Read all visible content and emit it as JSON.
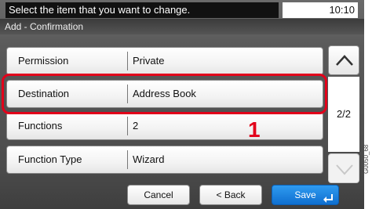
{
  "status": {
    "message": "Select the item that you want to change.",
    "time": "10:10"
  },
  "screen_title": "Add - Confirmation",
  "rows": [
    {
      "label": "Permission",
      "value": "Private"
    },
    {
      "label": "Destination",
      "value": "Address Book"
    },
    {
      "label": "Functions",
      "value": "2"
    },
    {
      "label": "Function Type",
      "value": "Wizard"
    }
  ],
  "callout_number": "1",
  "page_indicator": "2/2",
  "buttons": {
    "cancel": "Cancel",
    "back": "< Back",
    "save": "Save"
  },
  "side_code": "G0050_68",
  "colors": {
    "highlight": "#e2001a",
    "save_button": "#1a80dc"
  },
  "icons": [
    "chevron-up-icon",
    "chevron-down-icon",
    "enter-icon"
  ]
}
